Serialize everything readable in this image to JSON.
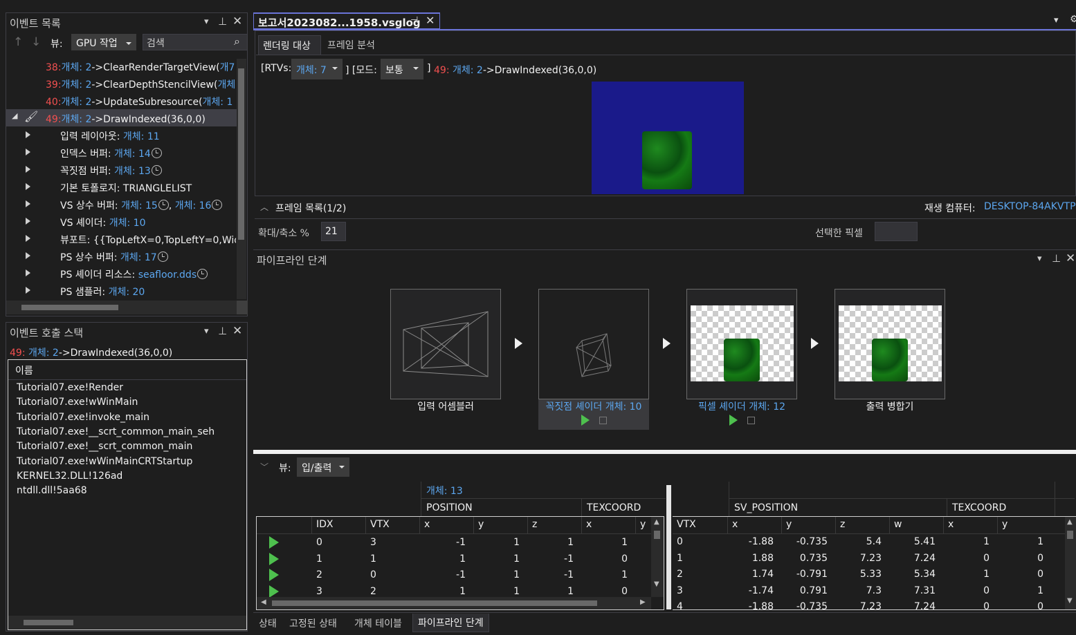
{
  "events": {
    "title": "이벤트 목록",
    "view_label": "뷰:",
    "view_value": "GPU 작업",
    "search_placeholder": "검색",
    "rows": [
      {
        "num": "38:",
        "obj": "개체: 2",
        "call": "->ClearRenderTargetView(",
        "tail": "개7"
      },
      {
        "num": "39:",
        "obj": "개체: 2",
        "call": "->ClearDepthStencilView(",
        "tail": "개체"
      },
      {
        "num": "40:",
        "obj": "개체: 2",
        "call": "->UpdateSubresource(",
        "tail": "개체: 1"
      },
      {
        "num": "49:",
        "obj": "개체: 2",
        "call": "->DrawIndexed(36,0,0)",
        "tail": ""
      }
    ],
    "children": [
      {
        "label": "입력 레이아웃: ",
        "val": "개체: 11",
        "clock": false,
        "val2": ""
      },
      {
        "label": "인덱스 버퍼: ",
        "val": "개체: 14",
        "clock": true,
        "val2": ""
      },
      {
        "label": "꼭짓점 버퍼: ",
        "val": "개체: 13",
        "clock": true,
        "val2": ""
      },
      {
        "label": "기본 토폴로지: TRIANGLELIST",
        "val": "",
        "clock": false,
        "val2": ""
      },
      {
        "label": "VS 상수 버퍼: ",
        "val": "개체: 15",
        "clock": true,
        "val2": "개체: 16"
      },
      {
        "label": "VS 셰이더: ",
        "val": "개체: 10",
        "clock": false,
        "val2": ""
      },
      {
        "label": "뷰포트: {{TopLeftX=0,TopLeftY=0,Wid",
        "val": "",
        "clock": false,
        "val2": ""
      },
      {
        "label": "PS 상수 버퍼: ",
        "val": "개체: 17",
        "clock": true,
        "val2": ""
      },
      {
        "label": "PS 셰이더 리소스: ",
        "val": "seafloor.dds",
        "clock": true,
        "val2": ""
      },
      {
        "label": "PS 샘플러: ",
        "val": "개체: 20",
        "clock": false,
        "val2": ""
      }
    ]
  },
  "callstack": {
    "title": "이벤트 호출 스택",
    "event_num": "49:",
    "event_obj": "개체: 2",
    "event_call": "->DrawIndexed(36,0,0)",
    "col_header": "이름",
    "frames": [
      "Tutorial07.exe!Render",
      "Tutorial07.exe!wWinMain",
      "Tutorial07.exe!invoke_main",
      "Tutorial07.exe!__scrt_common_main_seh",
      "Tutorial07.exe!__scrt_common_main",
      "Tutorial07.exe!wWinMainCRTStartup",
      "KERNEL32.DLL!126ad",
      "ntdll.dll!5aa68"
    ]
  },
  "doc": {
    "tab_title": "보고서2023082...1958.vsglog",
    "subtabs": [
      "렌더링 대상",
      "프레임 분석"
    ],
    "rtvs_label": "[RTVs:",
    "rtvs_value": "개체: 7",
    "mode_label": "] [모드:",
    "mode_value": "보통",
    "close_bracket": "]",
    "event_num": "49:",
    "event_obj": "개체: 2",
    "event_call": "->DrawIndexed(36,0,0)",
    "frame_list": "프레임 목록(1/2)",
    "playback_label": "재생 컴퓨터: ",
    "playback_value": "DESKTOP-84AKVTP",
    "zoom_label": "확대/축소 %",
    "zoom_value": "21",
    "selected_pixel": "선택한 픽셀"
  },
  "pipeline": {
    "title": "파이프라인 단계",
    "stages": [
      "입력 어셈블러",
      "꼭짓점 셰이더 ",
      "픽셀 셰이더 ",
      "출력 병합기"
    ],
    "vs_obj": "개체: 10",
    "ps_obj": "개체: 12"
  },
  "io": {
    "view_label": "뷰:",
    "view_value": "입/출력",
    "obj_label": "개체: 13",
    "left_groups": [
      "POSITION",
      "TEXCOORD"
    ],
    "left_cols": [
      "IDX",
      "VTX",
      "x",
      "y",
      "z",
      "x",
      "y"
    ],
    "left_rows": [
      [
        "0",
        "3",
        "-1",
        "1",
        "1",
        "1"
      ],
      [
        "1",
        "1",
        "1",
        "1",
        "-1",
        "0"
      ],
      [
        "2",
        "0",
        "-1",
        "1",
        "-1",
        "1"
      ],
      [
        "3",
        "2",
        "1",
        "1",
        "1",
        "0"
      ]
    ],
    "right_groups": [
      "SV_POSITION",
      "TEXCOORD"
    ],
    "right_cols": [
      "VTX",
      "x",
      "y",
      "z",
      "w",
      "x",
      "y"
    ],
    "right_rows": [
      [
        "0",
        "-1.88",
        "-0.735",
        "5.4",
        "5.41",
        "1",
        "1"
      ],
      [
        "1",
        "1.88",
        "0.735",
        "7.23",
        "7.24",
        "0",
        "0"
      ],
      [
        "2",
        "1.74",
        "-0.791",
        "5.33",
        "5.34",
        "1",
        "0"
      ],
      [
        "3",
        "-1.74",
        "0.791",
        "7.3",
        "7.31",
        "0",
        "1"
      ],
      [
        "4",
        "-1.88",
        "-0.735",
        "7.23",
        "7.24",
        "0",
        "0"
      ]
    ]
  },
  "bottom_tabs": [
    "상태",
    "고정된 상태",
    "개체 테이블",
    "파이프라인 단계"
  ]
}
